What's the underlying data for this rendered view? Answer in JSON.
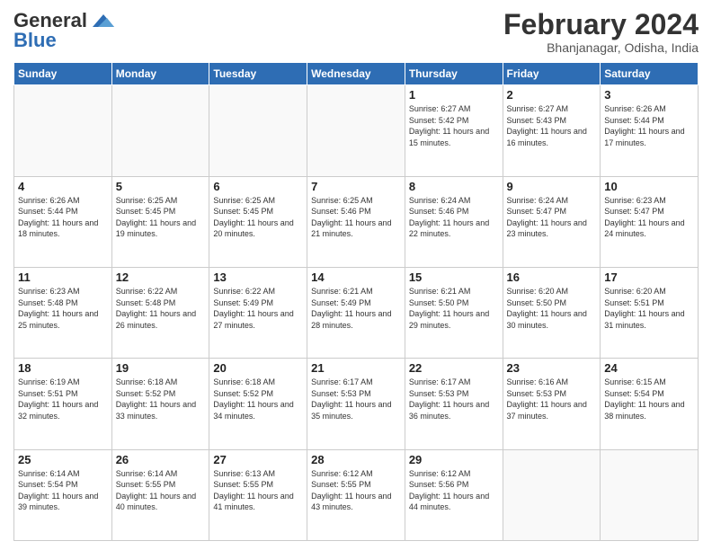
{
  "header": {
    "logo_line1": "General",
    "logo_line2": "Blue",
    "title": "February 2024",
    "subtitle": "Bhanjanagar, Odisha, India"
  },
  "weekdays": [
    "Sunday",
    "Monday",
    "Tuesday",
    "Wednesday",
    "Thursday",
    "Friday",
    "Saturday"
  ],
  "rows": [
    [
      {
        "day": "",
        "info": ""
      },
      {
        "day": "",
        "info": ""
      },
      {
        "day": "",
        "info": ""
      },
      {
        "day": "",
        "info": ""
      },
      {
        "day": "1",
        "info": "Sunrise: 6:27 AM\nSunset: 5:42 PM\nDaylight: 11 hours and 15 minutes."
      },
      {
        "day": "2",
        "info": "Sunrise: 6:27 AM\nSunset: 5:43 PM\nDaylight: 11 hours and 16 minutes."
      },
      {
        "day": "3",
        "info": "Sunrise: 6:26 AM\nSunset: 5:44 PM\nDaylight: 11 hours and 17 minutes."
      }
    ],
    [
      {
        "day": "4",
        "info": "Sunrise: 6:26 AM\nSunset: 5:44 PM\nDaylight: 11 hours and 18 minutes."
      },
      {
        "day": "5",
        "info": "Sunrise: 6:25 AM\nSunset: 5:45 PM\nDaylight: 11 hours and 19 minutes."
      },
      {
        "day": "6",
        "info": "Sunrise: 6:25 AM\nSunset: 5:45 PM\nDaylight: 11 hours and 20 minutes."
      },
      {
        "day": "7",
        "info": "Sunrise: 6:25 AM\nSunset: 5:46 PM\nDaylight: 11 hours and 21 minutes."
      },
      {
        "day": "8",
        "info": "Sunrise: 6:24 AM\nSunset: 5:46 PM\nDaylight: 11 hours and 22 minutes."
      },
      {
        "day": "9",
        "info": "Sunrise: 6:24 AM\nSunset: 5:47 PM\nDaylight: 11 hours and 23 minutes."
      },
      {
        "day": "10",
        "info": "Sunrise: 6:23 AM\nSunset: 5:47 PM\nDaylight: 11 hours and 24 minutes."
      }
    ],
    [
      {
        "day": "11",
        "info": "Sunrise: 6:23 AM\nSunset: 5:48 PM\nDaylight: 11 hours and 25 minutes."
      },
      {
        "day": "12",
        "info": "Sunrise: 6:22 AM\nSunset: 5:48 PM\nDaylight: 11 hours and 26 minutes."
      },
      {
        "day": "13",
        "info": "Sunrise: 6:22 AM\nSunset: 5:49 PM\nDaylight: 11 hours and 27 minutes."
      },
      {
        "day": "14",
        "info": "Sunrise: 6:21 AM\nSunset: 5:49 PM\nDaylight: 11 hours and 28 minutes."
      },
      {
        "day": "15",
        "info": "Sunrise: 6:21 AM\nSunset: 5:50 PM\nDaylight: 11 hours and 29 minutes."
      },
      {
        "day": "16",
        "info": "Sunrise: 6:20 AM\nSunset: 5:50 PM\nDaylight: 11 hours and 30 minutes."
      },
      {
        "day": "17",
        "info": "Sunrise: 6:20 AM\nSunset: 5:51 PM\nDaylight: 11 hours and 31 minutes."
      }
    ],
    [
      {
        "day": "18",
        "info": "Sunrise: 6:19 AM\nSunset: 5:51 PM\nDaylight: 11 hours and 32 minutes."
      },
      {
        "day": "19",
        "info": "Sunrise: 6:18 AM\nSunset: 5:52 PM\nDaylight: 11 hours and 33 minutes."
      },
      {
        "day": "20",
        "info": "Sunrise: 6:18 AM\nSunset: 5:52 PM\nDaylight: 11 hours and 34 minutes."
      },
      {
        "day": "21",
        "info": "Sunrise: 6:17 AM\nSunset: 5:53 PM\nDaylight: 11 hours and 35 minutes."
      },
      {
        "day": "22",
        "info": "Sunrise: 6:17 AM\nSunset: 5:53 PM\nDaylight: 11 hours and 36 minutes."
      },
      {
        "day": "23",
        "info": "Sunrise: 6:16 AM\nSunset: 5:53 PM\nDaylight: 11 hours and 37 minutes."
      },
      {
        "day": "24",
        "info": "Sunrise: 6:15 AM\nSunset: 5:54 PM\nDaylight: 11 hours and 38 minutes."
      }
    ],
    [
      {
        "day": "25",
        "info": "Sunrise: 6:14 AM\nSunset: 5:54 PM\nDaylight: 11 hours and 39 minutes."
      },
      {
        "day": "26",
        "info": "Sunrise: 6:14 AM\nSunset: 5:55 PM\nDaylight: 11 hours and 40 minutes."
      },
      {
        "day": "27",
        "info": "Sunrise: 6:13 AM\nSunset: 5:55 PM\nDaylight: 11 hours and 41 minutes."
      },
      {
        "day": "28",
        "info": "Sunrise: 6:12 AM\nSunset: 5:55 PM\nDaylight: 11 hours and 43 minutes."
      },
      {
        "day": "29",
        "info": "Sunrise: 6:12 AM\nSunset: 5:56 PM\nDaylight: 11 hours and 44 minutes."
      },
      {
        "day": "",
        "info": ""
      },
      {
        "day": "",
        "info": ""
      }
    ]
  ]
}
